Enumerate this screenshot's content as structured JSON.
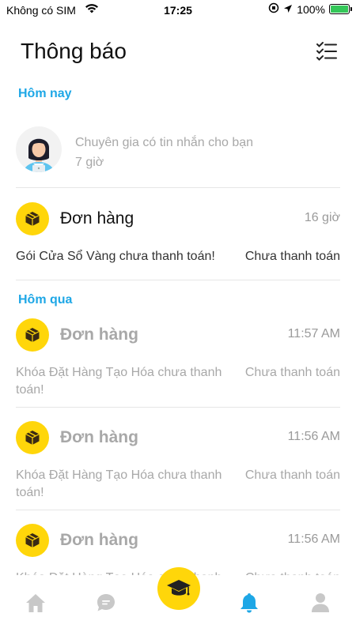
{
  "status_bar": {
    "carrier": "Không có SIM",
    "time": "17:25",
    "battery": "100%",
    "battery_level": 1.0
  },
  "header": {
    "title": "Thông báo",
    "mark_all_icon": "checklist-icon"
  },
  "sections": {
    "today": "Hôm nay",
    "yesterday": "Hôm qua"
  },
  "expert_message": {
    "title": "Chuyên gia có tin nhắn cho bạn",
    "time": "7 giờ"
  },
  "today_order": {
    "title": "Đơn hàng",
    "time": "16 giờ",
    "description": "Gói Cửa Sổ Vàng chưa thanh toán!",
    "status": "Chưa thanh toán"
  },
  "yesterday_orders": [
    {
      "title": "Đơn hàng",
      "time": "11:57 AM",
      "description": "Khóa Đặt Hàng Tạo Hóa chưa thanh toán!",
      "status": "Chưa thanh toán"
    },
    {
      "title": "Đơn hàng",
      "time": "11:56 AM",
      "description": "Khóa Đặt Hàng Tạo Hóa chưa thanh toán!",
      "status": "Chưa thanh toán"
    },
    {
      "title": "Đơn hàng",
      "time": "11:56 AM",
      "description": "Khóa Đặt Hàng Tạo Hóa chưa thanh toán!",
      "status": "Chưa thanh toán"
    }
  ],
  "tabbar": {
    "tabs": [
      "home-icon",
      "chat-icon",
      "graduation-cap-icon",
      "bell-icon",
      "user-icon"
    ],
    "active": "bell-icon",
    "accent_color": "#1ea7e6",
    "brand_color": "#ffd60a"
  }
}
